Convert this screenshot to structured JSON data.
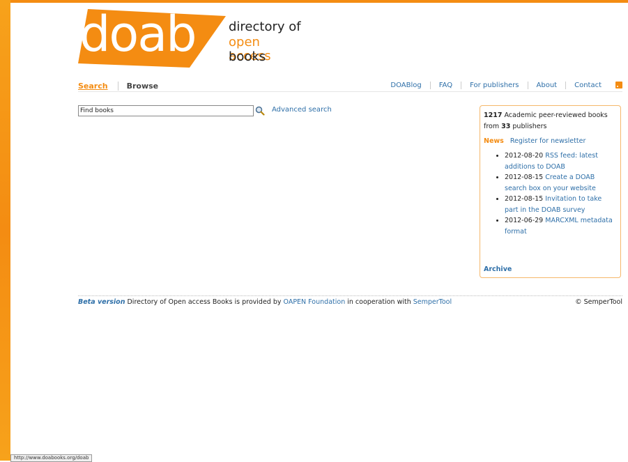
{
  "brand": {
    "logo_word": "doab",
    "tagline_1": "directory of",
    "tagline_2": "open access",
    "tagline_3": "books",
    "accent_color": "#f48c12",
    "link_color": "#2e6fa8"
  },
  "tabs": [
    {
      "label": "Search",
      "active": true
    },
    {
      "label": "Browse",
      "active": false
    }
  ],
  "topnav": [
    "DOABlog",
    "FAQ",
    "For publishers",
    "About",
    "Contact"
  ],
  "rss_icon": "rss-icon",
  "search": {
    "value": "Find books",
    "icon": "magnifier-icon",
    "advanced_label": "Advanced search"
  },
  "panel": {
    "book_count": "1217",
    "text_books": " Academic peer-reviewed books",
    "text_from": "from ",
    "publisher_count": "33",
    "text_publishers": " publishers",
    "news_title": "News",
    "newsletter_label": "Register for newsletter",
    "news": [
      {
        "date": "2012-08-20",
        "title": "RSS feed: latest additions to DOAB"
      },
      {
        "date": "2012-08-15",
        "title": "Create a DOAB search box on your website"
      },
      {
        "date": "2012-08-15",
        "title": "Invitation to take part in the DOAB survey"
      },
      {
        "date": "2012-06-29",
        "title": "MARCXML metadata format"
      }
    ],
    "archive_label": "Archive"
  },
  "footer": {
    "beta": "Beta version",
    "text_1": " Directory of Open access Books is provided by ",
    "link_1": "OAPEN Foundation",
    "text_2": " in cooperation with ",
    "link_2": "SemperTool",
    "copyright": "© SemperTool"
  },
  "statusbar": "http://www.doabooks.org/doab"
}
